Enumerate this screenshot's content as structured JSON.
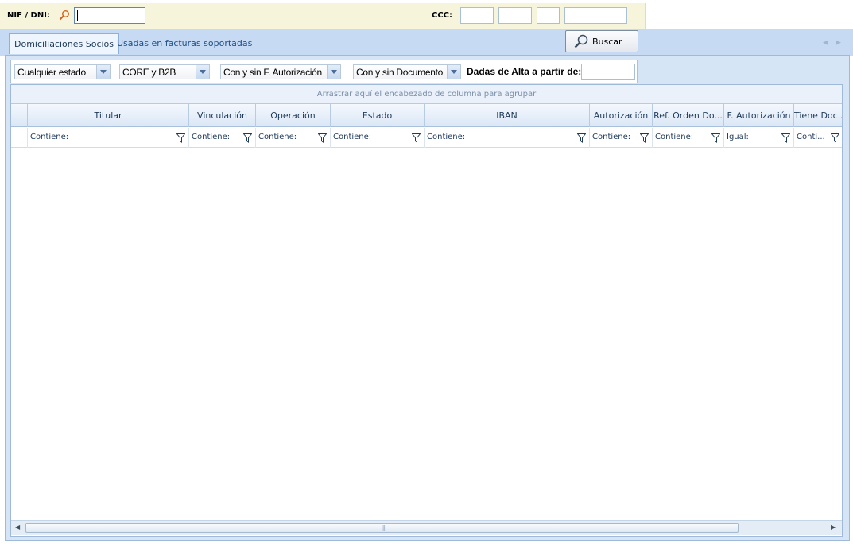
{
  "search": {
    "nif_label": "NIF / DNI:",
    "nif_value": "",
    "ccc_label": "CCC:"
  },
  "tabs": [
    {
      "label": "Domiciliaciones Socios",
      "active": true
    },
    {
      "label": "Usadas en facturas soportadas",
      "active": false
    }
  ],
  "buscar_label": "Buscar",
  "filters": {
    "estado": "Cualquier estado",
    "tipo": "CORE y B2B",
    "autorizacion": "Con y sin F. Autorización",
    "documento": "Con y sin Documento",
    "alta_label": "Dadas de Alta a partir de:",
    "alta_value": ""
  },
  "grid": {
    "group_hint": "Arrastrar aquí el encabezado de columna para agrupar",
    "columns": [
      {
        "label": "Titular",
        "filter": "Contiene:"
      },
      {
        "label": "Vinculación",
        "filter": "Contiene:"
      },
      {
        "label": "Operación",
        "filter": "Contiene:"
      },
      {
        "label": "Estado",
        "filter": "Contiene:"
      },
      {
        "label": "IBAN",
        "filter": "Contiene:"
      },
      {
        "label": "Autorización",
        "filter": "Contiene:"
      },
      {
        "label": "Ref. Orden Do...",
        "filter": "Contiene:"
      },
      {
        "label": "F. Autorización",
        "filter": "Igual:"
      },
      {
        "label": "Tiene Doc...",
        "filter": "Conti..."
      }
    ]
  },
  "icons": {
    "search": "magnifier-icon",
    "filter": "funnel-icon",
    "scroll_left": "arrow-left-icon",
    "scroll_right": "arrow-right-icon"
  },
  "colors": {
    "topbar": "#f7f4dc",
    "panel": "#d6e5f6",
    "tabstrip": "#c6dbf3",
    "accent": "#1e4e8c"
  }
}
